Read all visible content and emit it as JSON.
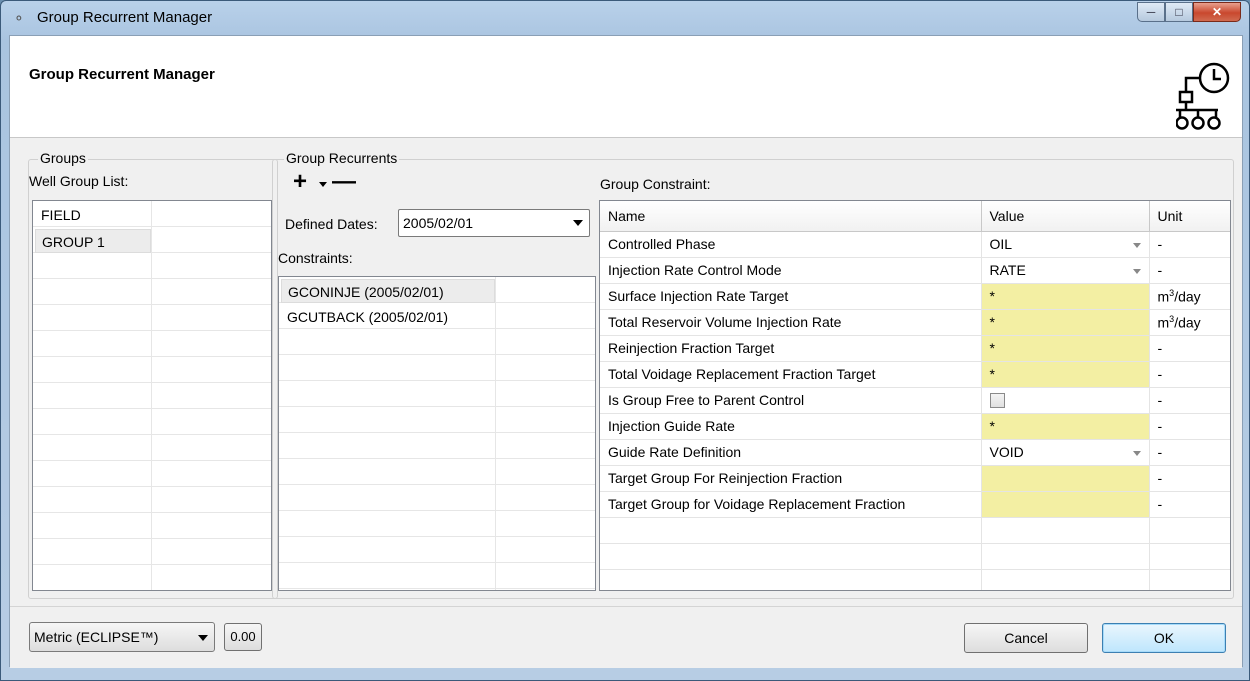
{
  "window": {
    "title": "Group Recurrent Manager"
  },
  "header": {
    "title": "Group Recurrent Manager",
    "icon": "group-schedule-icon"
  },
  "groups": {
    "legend": "Groups",
    "list_label": "Well Group List:",
    "items": [
      "FIELD",
      "GROUP 1"
    ],
    "selected": "GROUP 1"
  },
  "recurrents": {
    "legend": "Group Recurrents",
    "add_symbol": "+",
    "remove_symbol": "—",
    "defined_dates_label": "Defined Dates:",
    "defined_dates_value": "2005/02/01",
    "constraints_label": "Constraints:",
    "constraints": [
      "GCONINJE (2005/02/01)",
      "GCUTBACK (2005/02/01)"
    ],
    "selected": "GCONINJE (2005/02/01)"
  },
  "constraint_table": {
    "label": "Group Constraint:",
    "columns": [
      "Name",
      "Value",
      "Unit"
    ],
    "rows": [
      {
        "name": "Controlled Phase",
        "value": "OIL",
        "unit": "-",
        "type": "dropdown"
      },
      {
        "name": "Injection Rate Control Mode",
        "value": "RATE",
        "unit": "-",
        "type": "dropdown"
      },
      {
        "name": "Surface Injection Rate Target",
        "value": "*",
        "unit": "m",
        "unit_sup": "3",
        "unit_tail": "/day",
        "type": "yellow"
      },
      {
        "name": "Total Reservoir Volume Injection Rate",
        "value": "*",
        "unit": "m",
        "unit_sup": "3",
        "unit_tail": "/day",
        "type": "yellow"
      },
      {
        "name": "Reinjection Fraction Target",
        "value": "*",
        "unit": "-",
        "type": "yellow"
      },
      {
        "name": "Total Voidage Replacement Fraction Target",
        "value": "*",
        "unit": "-",
        "type": "yellow"
      },
      {
        "name": "Is Group Free to Parent Control",
        "value": "",
        "unit": "-",
        "type": "checkbox"
      },
      {
        "name": "Injection Guide Rate",
        "value": "*",
        "unit": "-",
        "type": "yellow"
      },
      {
        "name": "Guide Rate Definition",
        "value": "VOID",
        "unit": "-",
        "type": "dropdown"
      },
      {
        "name": "Target Group For Reinjection Fraction",
        "value": "",
        "unit": "-",
        "type": "yellow"
      },
      {
        "name": "Target Group for Voidage Replacement Fraction",
        "value": "",
        "unit": "-",
        "type": "yellow"
      }
    ]
  },
  "footer": {
    "unit_system": "Metric (ECLIPSE™)",
    "number_button": "0.00",
    "cancel_label": "Cancel",
    "ok_label": "OK"
  }
}
